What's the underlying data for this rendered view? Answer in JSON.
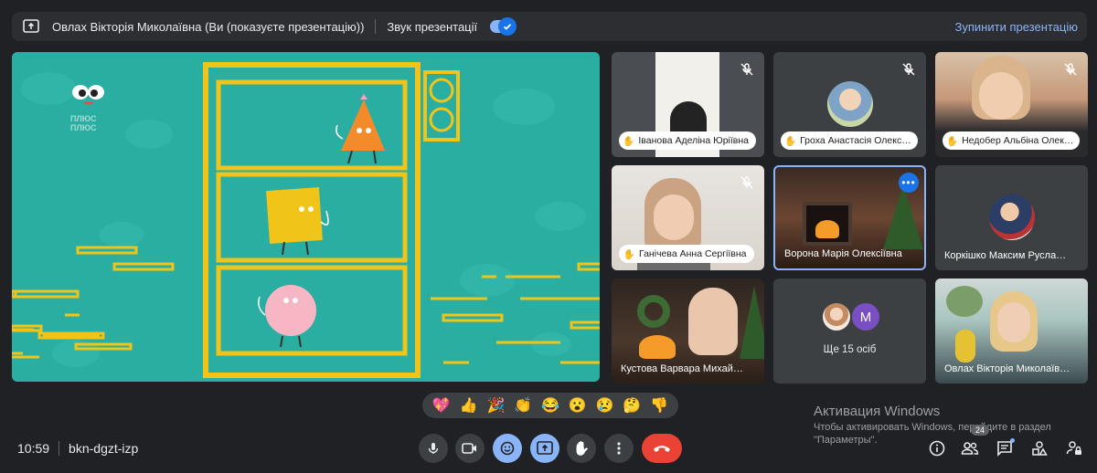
{
  "topbar": {
    "presenter_label": "Овлах Вікторія Миколаївна (Ви (показуєте презентацію))",
    "sound_label": "Звук презентації",
    "stop_label": "Зупинити презентацію"
  },
  "stage": {
    "logo_text_1": "ПЛЮС",
    "logo_text_2": "ПЛЮС"
  },
  "tiles": [
    {
      "name": "Іванова Аделіна Юріївна",
      "muted": true
    },
    {
      "name": "Гроха Анастасія Олекс…",
      "muted": true
    },
    {
      "name": "Недобер Альбіна Олек…",
      "muted": true
    },
    {
      "name": "Ганічева Анна Сергіївна",
      "muted": true
    },
    {
      "name": "Ворона Марія Олексіївна",
      "muted": false
    },
    {
      "name": "Коркішко Максим Русла…",
      "muted": false
    },
    {
      "name": "Кустова Варвара Михай…",
      "muted": false
    },
    {
      "name": "Ще 15 осіб",
      "avatar_letter": "M"
    },
    {
      "name": "Овлах Вікторія Миколаїв…",
      "muted": false
    }
  ],
  "reactions": [
    "💖",
    "👍",
    "🎉",
    "👏",
    "😂",
    "😮",
    "😢",
    "🤔",
    "👎"
  ],
  "meeting": {
    "time": "10:59",
    "code": "bkn-dgzt-izp"
  },
  "people_count": "24",
  "windows_activation": {
    "title": "Активация Windows",
    "line1": "Чтобы активировать Windows, перейдите в раздел",
    "line2": "\"Параметры\"."
  },
  "colors": {
    "background": "#202124",
    "accent": "#8ab4f8",
    "end_call": "#ea4335",
    "stage": "#2aaea2"
  }
}
